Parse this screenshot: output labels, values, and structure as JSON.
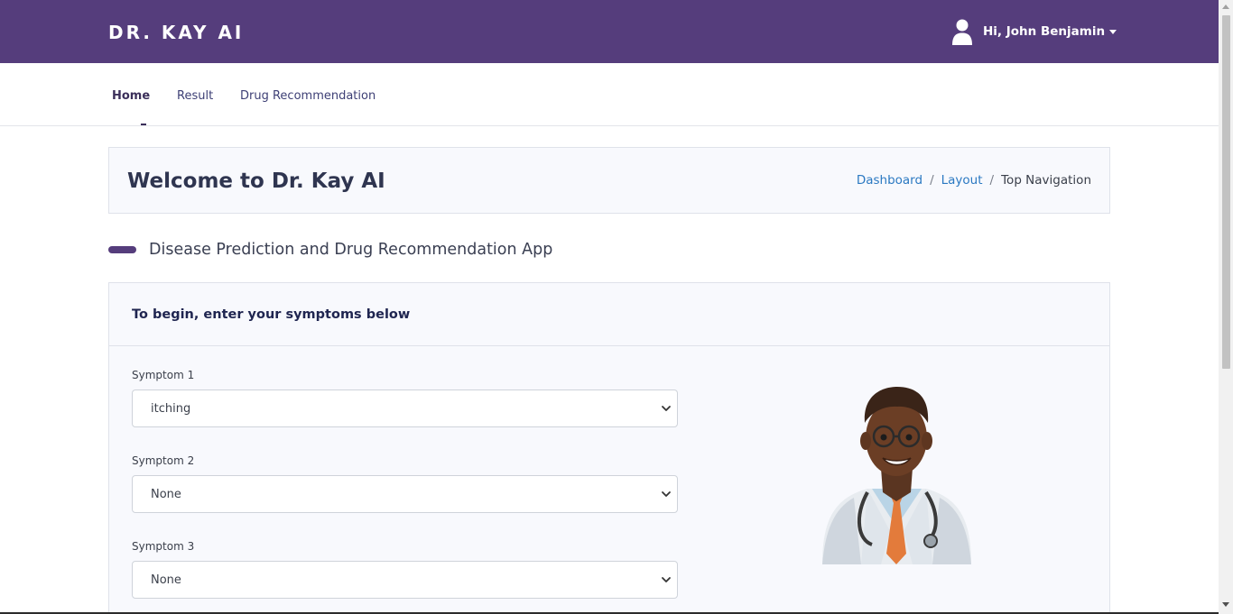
{
  "header": {
    "brand": "DR. KAY AI",
    "user_greeting": "Hi, John Benjamin",
    "bg_color": "#553d7c"
  },
  "nav": {
    "items": [
      {
        "label": "Home",
        "active": true
      },
      {
        "label": "Result",
        "active": false
      },
      {
        "label": "Drug Recommendation",
        "active": false
      }
    ]
  },
  "welcome": {
    "title": "Welcome to Dr. Kay AI",
    "breadcrumb": [
      {
        "label": "Dashboard",
        "link": true
      },
      {
        "label": "Layout",
        "link": true
      },
      {
        "label": "Top Navigation",
        "link": false
      }
    ],
    "separator": "/"
  },
  "section": {
    "title": "Disease Prediction and Drug Recommendation App"
  },
  "form": {
    "heading": "To begin, enter your symptoms below",
    "fields": [
      {
        "label": "Symptom 1",
        "value": "itching"
      },
      {
        "label": "Symptom 2",
        "value": "None"
      },
      {
        "label": "Symptom 3",
        "value": "None"
      }
    ]
  },
  "icons": [
    "user-avatar-icon",
    "caret-down-icon",
    "chevron-down-icon",
    "doctor-illustration"
  ]
}
